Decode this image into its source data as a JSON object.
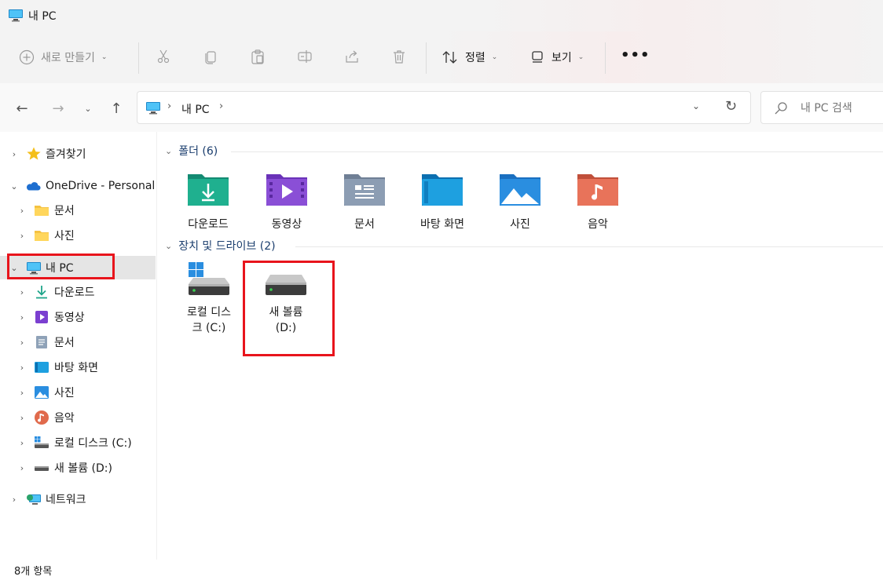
{
  "window": {
    "title": "내 PC"
  },
  "toolbar": {
    "new_label": "새로 만들기",
    "sort_label": "정렬",
    "view_label": "보기",
    "more_label": "•••"
  },
  "address": {
    "path": "내 PC",
    "sep": "›"
  },
  "search": {
    "placeholder": "내 PC 검색"
  },
  "sidebar": {
    "quick_access": "즐겨찾기",
    "onedrive": "OneDrive - Personal",
    "od_docs": "문서",
    "od_photos": "사진",
    "this_pc": "내 PC",
    "downloads": "다운로드",
    "videos": "동영상",
    "documents": "문서",
    "desktop": "바탕 화면",
    "pictures": "사진",
    "music": "음악",
    "local_disk": "로컬 디스크 (C:)",
    "new_volume": "새 볼륨 (D:)",
    "network": "네트워크"
  },
  "main": {
    "folders_header": "폴더 (6)",
    "folders": [
      {
        "label": "다운로드"
      },
      {
        "label": "동영상"
      },
      {
        "label": "문서"
      },
      {
        "label": "바탕 화면"
      },
      {
        "label": "사진"
      },
      {
        "label": "음악"
      }
    ],
    "drives_header": "장치 및 드라이브 (2)",
    "drives": [
      {
        "line1": "로컬 디스",
        "line2": "크 (C:)"
      },
      {
        "line1": "새 볼륨",
        "line2": "(D:)"
      }
    ]
  },
  "status": {
    "items": "8개 항목"
  },
  "colors": {
    "highlight": "#e8141c",
    "selected": "#e5e5e5",
    "folder_teal": "#1fa58a",
    "folder_purple": "#8a4fd6"
  }
}
